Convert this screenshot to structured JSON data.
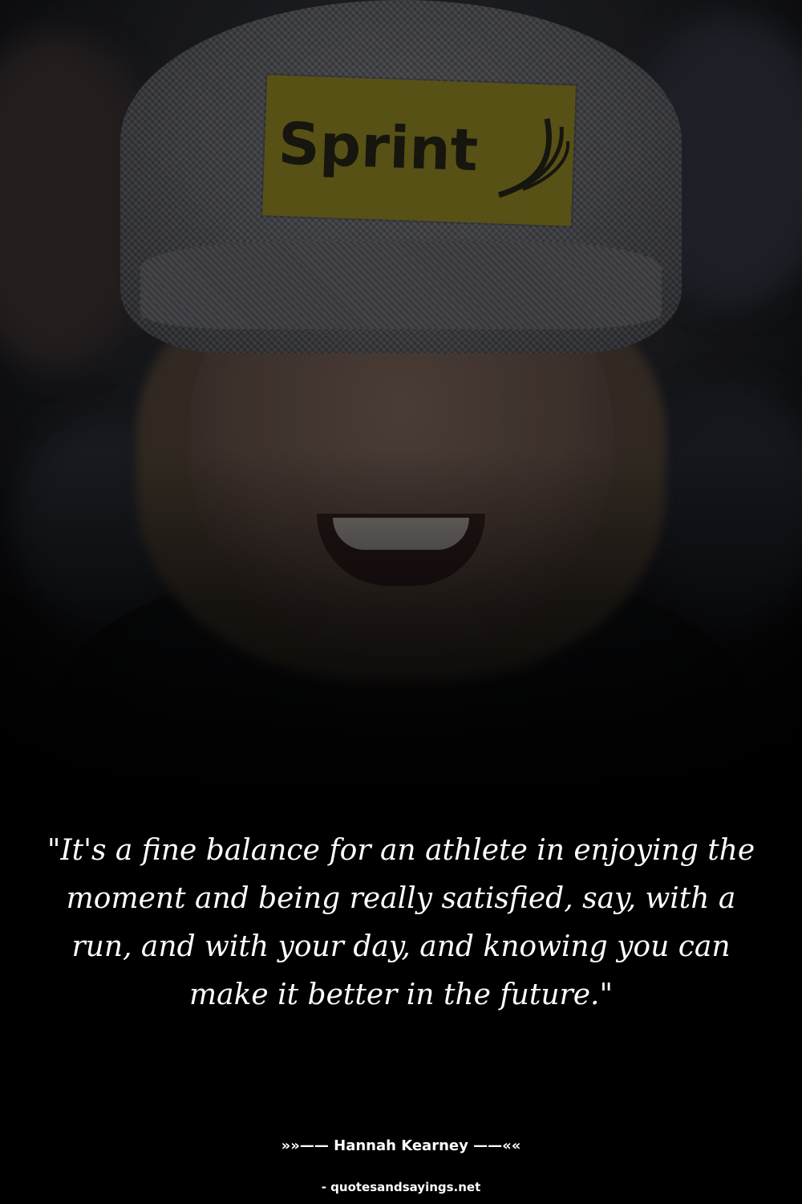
{
  "photo": {
    "logo_text": "Sprint"
  },
  "quote": {
    "text": "\"It's a fine balance for an athlete in enjoying the moment and being really satisfied, say, with a run, and with your day, and knowing you can make it better in the future.\""
  },
  "author": {
    "text": "»»—— Hannah Kearney ——««"
  },
  "source": {
    "text": "- quotesandsayings.net"
  },
  "colors": {
    "background": "#000000",
    "text": "#ffffff",
    "patch": "#6b631c"
  }
}
